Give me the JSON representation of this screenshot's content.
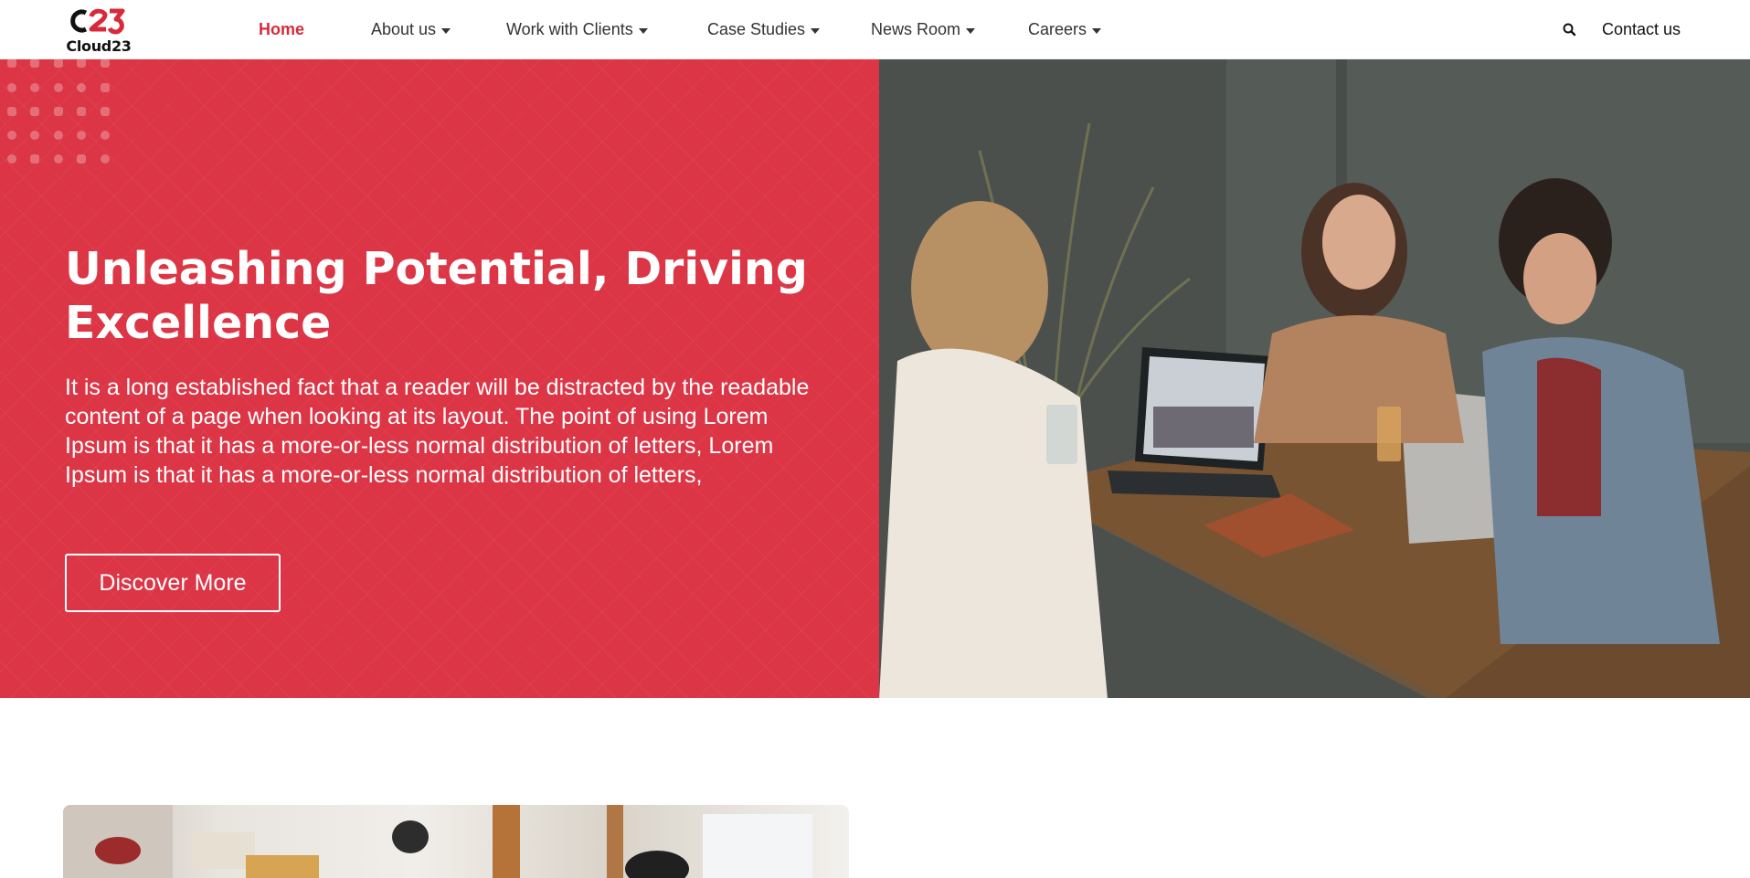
{
  "header": {
    "logo_text": "Cloud23",
    "logo_mark_text": "c23",
    "nav": [
      {
        "label": "Home",
        "active": true,
        "dropdown": false
      },
      {
        "label": "About us",
        "active": false,
        "dropdown": true
      },
      {
        "label": "Work with Clients",
        "active": false,
        "dropdown": true
      },
      {
        "label": "Case Studies",
        "active": false,
        "dropdown": true
      },
      {
        "label": "News Room",
        "active": false,
        "dropdown": true
      },
      {
        "label": "Careers",
        "active": false,
        "dropdown": true
      }
    ],
    "search_icon": "search-icon",
    "contact_label": "Contact us"
  },
  "hero": {
    "title": "Unleashing Potential, Driving Excellence",
    "text": "It is a long established fact that a reader will be distracted by the readable content of a page when looking at its layout. The point of using Lorem Ipsum is that it has a more-or-less normal distribution of letters, Lorem Ipsum is that it has a more-or-less normal distribution of letters,",
    "button_label": "Discover More",
    "image": "photo of three women laughing around a wooden table with laptops"
  },
  "section": {
    "image": "photo of people working in a bright office"
  },
  "colors": {
    "brand_red": "#dc3545",
    "active_nav": "#d8293a",
    "text_dark": "#333333",
    "white": "#ffffff"
  }
}
